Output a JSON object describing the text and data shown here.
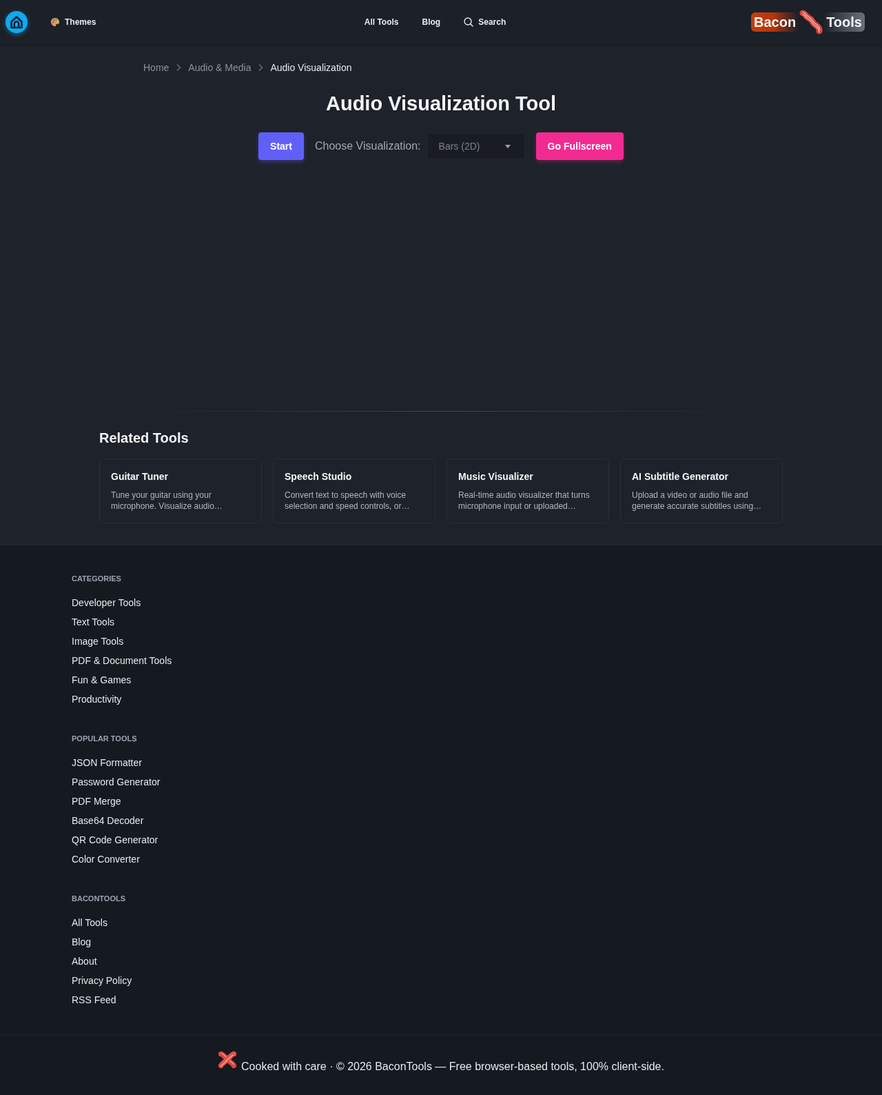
{
  "header": {
    "themes_button": "Themes",
    "nav": [
      {
        "kind": "link",
        "label": "All Tools"
      },
      {
        "kind": "link",
        "label": "Blog"
      },
      {
        "kind": "search",
        "label": "Search"
      }
    ],
    "logo": {
      "left": "Bacon",
      "right": "Tools"
    }
  },
  "breadcrumb": [
    {
      "label": "Home",
      "current": false
    },
    {
      "label": "Audio & Media",
      "current": false
    },
    {
      "label": "Audio Visualization",
      "current": true
    }
  ],
  "title": "Audio Visualization Tool",
  "controls": {
    "start_button": "Start",
    "select_label": "Choose Visualization:",
    "select_value": "Bars (2D)",
    "fullscreen_button": "Go Fullscreen"
  },
  "related_tools": {
    "heading": "Related Tools",
    "cards": [
      {
        "title": "Guitar Tuner",
        "description": "Tune your guitar using your microphone. Visualize audio…"
      },
      {
        "title": "Speech Studio",
        "description": "Convert text to speech with voice selection and speed controls, or…"
      },
      {
        "title": "Music Visualizer",
        "description": "Real-time audio visualizer that turns microphone input or uploaded…"
      },
      {
        "title": "AI Subtitle Generator",
        "description": "Upload a video or audio file and generate accurate subtitles using…"
      }
    ]
  },
  "footer": {
    "sections": [
      {
        "heading": "CATEGORIES",
        "links": [
          "Developer Tools",
          "Text Tools",
          "Image Tools",
          "PDF & Document Tools",
          "Fun & Games",
          "Productivity"
        ]
      },
      {
        "heading": "POPULAR TOOLS",
        "links": [
          "JSON Formatter",
          "Password Generator",
          "PDF Merge",
          "Base64 Decoder",
          "QR Code Generator",
          "Color Converter"
        ]
      },
      {
        "heading": "BACONTOOLS",
        "links": [
          "All Tools",
          "Blog",
          "About",
          "Privacy Policy",
          "RSS Feed"
        ]
      }
    ],
    "copyright": "Cooked with care · © 2026 BaconTools — Free browser-based tools, 100% client-side."
  }
}
